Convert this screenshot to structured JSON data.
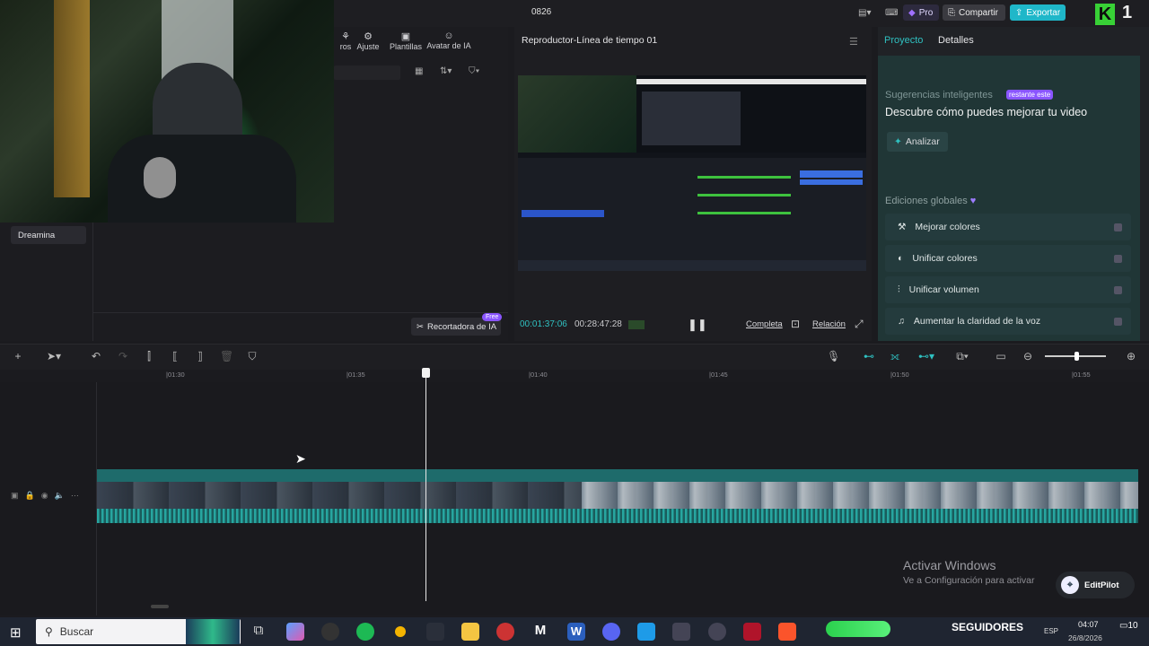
{
  "app": {
    "title": "0826",
    "pro_label": "Pro",
    "share_label": "Compartir",
    "export_label": "Exportar",
    "badge_number": "1"
  },
  "left_panel": {
    "tabs": [
      "ros",
      "Ajuste",
      "Plantillas",
      "Avatar de IA"
    ],
    "sidebar_item": "Dreamina",
    "recortadora_label": "Recortadora de IA",
    "free_badge": "Free"
  },
  "player": {
    "title": "Reproductor-Línea de tiempo 01",
    "current_time": "00:01:37:06",
    "total_time": "00:28:47:28",
    "complete_label": "Completa",
    "ratio_label": "Relación"
  },
  "right_panel": {
    "tabs": [
      "Proyecto",
      "Detalles"
    ],
    "smart_title": "Sugerencias inteligentes",
    "smart_badge": "restante este",
    "smart_heading": "Descubre cómo puedes mejorar tu video",
    "analyze_label": "Analizar",
    "global_edits_title": "Ediciones globales",
    "global_edits": [
      {
        "label": "Mejorar colores",
        "icon": "magic-wand-icon"
      },
      {
        "label": "Unificar colores",
        "icon": "color-icon"
      },
      {
        "label": "Unificar volumen",
        "icon": "sliders-icon"
      },
      {
        "label": "Aumentar la claridad de la voz",
        "icon": "voice-icon"
      }
    ]
  },
  "timeline": {
    "ticks": [
      "|01:30",
      "|01:35",
      "|01:40",
      "|01:45",
      "|01:50",
      "|01:55"
    ]
  },
  "watermark": {
    "line1": "Activar Windows",
    "line2": "Ve a Configuración para activar",
    "editpilot": "EditPilot"
  },
  "taskbar": {
    "search_placeholder": "Buscar",
    "followers_label": "SEGUIDORES",
    "language": "ESP",
    "time": "04:07",
    "date": "26/8/2026",
    "notif_count": "10"
  },
  "colors": {
    "accent": "#29c1c1",
    "pro": "#7b4dff",
    "export": "#1fb7c9",
    "clip": "#1e6b6b"
  }
}
